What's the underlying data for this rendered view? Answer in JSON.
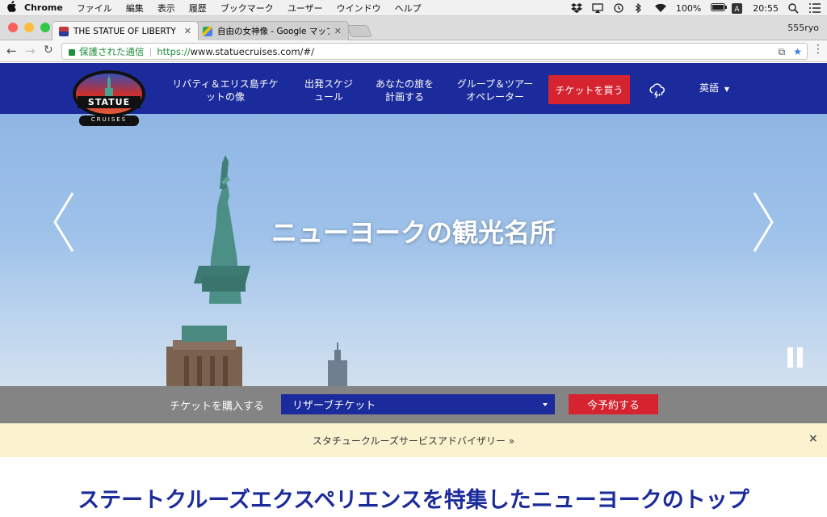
{
  "os_menubar": {
    "app": "Chrome",
    "items": [
      "ファイル",
      "編集",
      "表示",
      "履歴",
      "ブックマーク",
      "ユーザー",
      "ウインドウ",
      "ヘルプ"
    ],
    "battery": "100%",
    "time": "20:55"
  },
  "browser": {
    "tabs": [
      {
        "title": "THE STATUE OF LIBERTY EXPI",
        "active": true
      },
      {
        "title": "自由の女神像 - Google マップ",
        "active": false
      }
    ],
    "profile": "555ryo",
    "secure_label": "保護された通信",
    "url_scheme": "https://",
    "url_rest": "www.statuecruises.com/#/"
  },
  "site": {
    "logo": {
      "top": "STATUE",
      "bottom": "CRUISES"
    },
    "nav": [
      {
        "line1": "リバティ＆エリス島チケ",
        "line2": "ットの像"
      },
      {
        "line1": "出発スケジ",
        "line2": "ュール"
      },
      {
        "line1": "あなたの旅を",
        "line2": "計画する"
      },
      {
        "line1": "グループ＆ツアー",
        "line2": "オペレーター"
      }
    ],
    "buy_button": "チケットを買う",
    "language": "英語",
    "hero_title": "ニューヨークの観光名所",
    "booking": {
      "label": "チケットを購入する",
      "selected": "リザーブチケット",
      "reserve_button": "今予約する"
    },
    "advisory": "スタチュークルーズサービスアドバイザリー »",
    "advisory_close": "×",
    "headline": "ステートクルーズエクスペリエンスを特集したニューヨークのトップ"
  },
  "colors": {
    "nav_blue": "#1b2b9b",
    "cta_red": "#d5232f",
    "advisory_bg": "#fbf3cf"
  }
}
